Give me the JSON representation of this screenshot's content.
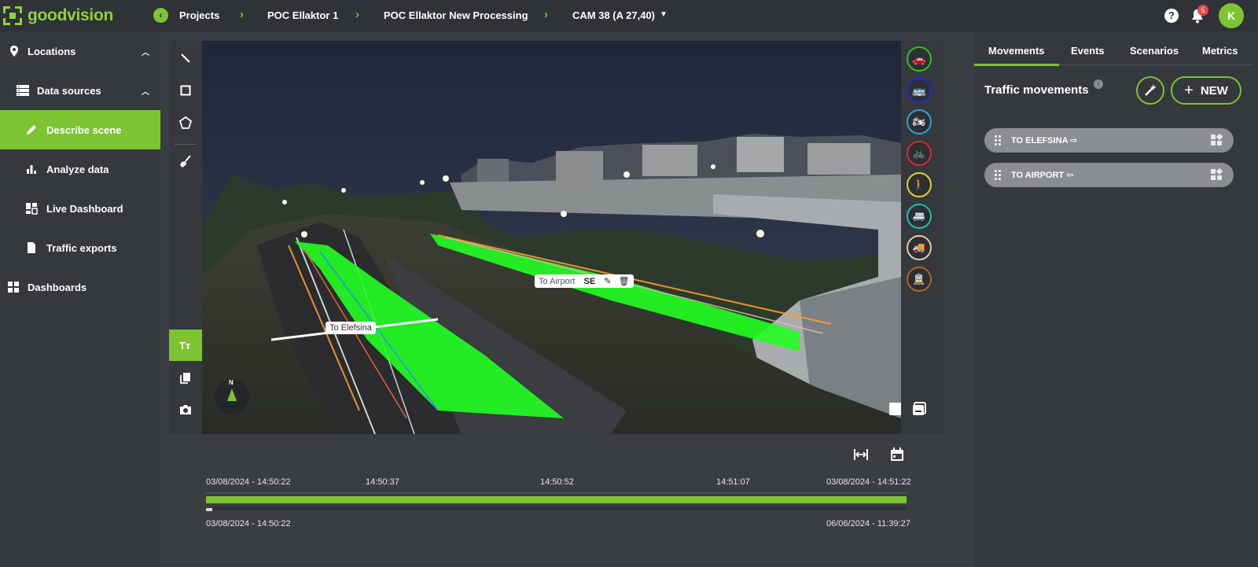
{
  "app": {
    "brand": "goodvision"
  },
  "breadcrumb": {
    "items": [
      "Projects",
      "POC Ellaktor 1",
      "POC Ellaktor New Processing",
      "CAM 38 (A 27,40)"
    ]
  },
  "header": {
    "notification_count": "5",
    "avatar_initial": "K"
  },
  "sidebar": {
    "items": [
      {
        "label": "Locations",
        "icon": "location-pin-icon"
      },
      {
        "label": "Data sources",
        "icon": "server-icon"
      },
      {
        "label": "Describe scene",
        "icon": "pencil-icon",
        "active": true
      },
      {
        "label": "Analyze data",
        "icon": "bar-chart-icon"
      },
      {
        "label": "Live Dashboard",
        "icon": "dashboard-icon"
      },
      {
        "label": "Traffic exports",
        "icon": "document-icon"
      },
      {
        "label": "Dashboards",
        "icon": "dashboards-grid-icon"
      }
    ]
  },
  "scene": {
    "labels": {
      "to_airport": "To Airport",
      "to_airport_dir": "SE",
      "to_elefsina": "To Elefsina"
    },
    "compass": "N"
  },
  "vehicle_classes": [
    {
      "name": "car",
      "color": "#2ec22e"
    },
    {
      "name": "bus",
      "color": "#1e2ad6"
    },
    {
      "name": "motorcycle",
      "color": "#2aa2e0"
    },
    {
      "name": "bicycle",
      "color": "#d92b2b"
    },
    {
      "name": "pedestrian",
      "color": "#e6d21e"
    },
    {
      "name": "van",
      "color": "#1fbfae"
    },
    {
      "name": "truck",
      "color": "#e8c9a0"
    },
    {
      "name": "tram",
      "color": "#b8621e"
    }
  ],
  "timeline": {
    "top_start": "03/08/2024 - 14:50:22",
    "ticks": [
      "14:50:37",
      "14:50:52",
      "14:51:07"
    ],
    "top_end": "03/08/2024 - 14:51:22",
    "bottom_start": "03/08/2024 - 14:50:22",
    "bottom_end": "06/06/2024 - 11:39:27"
  },
  "panel": {
    "tabs": [
      "Movements",
      "Events",
      "Scenarios",
      "Metrics"
    ],
    "active_tab": "Movements",
    "title": "Traffic movements",
    "new_label": "NEW",
    "movements": [
      {
        "label": "TO ELEFSINA ⇨"
      },
      {
        "label": "TO AIRPORT ⇦"
      }
    ]
  },
  "colors": {
    "accent": "#7dc432",
    "topbar": "#2f3236",
    "panel": "#35383c"
  }
}
